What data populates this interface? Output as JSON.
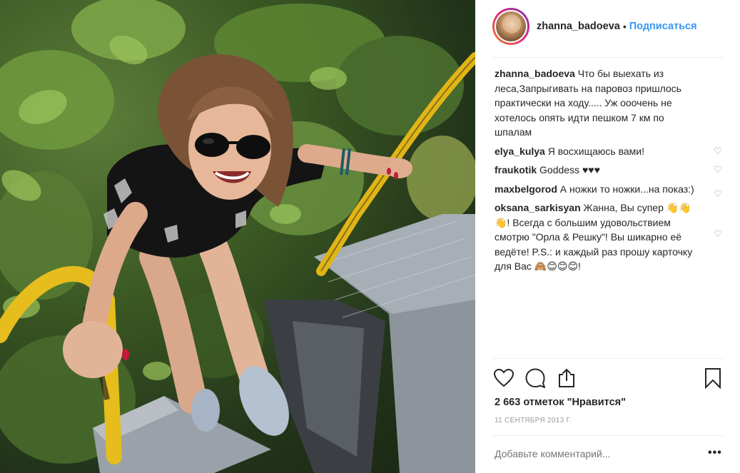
{
  "post": {
    "image_alt": "Woman in sunglasses climbing a locomotive ladder with yellow handrails in a forest"
  },
  "header": {
    "username": "zhanna_badoeva",
    "separator": "•",
    "follow_label": "Подписаться"
  },
  "caption": {
    "author": "zhanna_badoeva",
    "text": "Что бы выехать из леса,Запрыгивать на паровоз пришлось практически на ходу..... Уж ооочень не хотелось опять идти пешком 7 км по шпалам"
  },
  "comments": [
    {
      "author": "elya_kulya",
      "text": "Я восхищаюсь вами!"
    },
    {
      "author": "fraukotik",
      "text": "Goddess ♥♥♥"
    },
    {
      "author": "maxbelgorod",
      "text": "А ножки то ножки...на показ:)"
    },
    {
      "author": "oksana_sarkisyan",
      "text": "Жанна, Вы супер 👋👋👋! Всегда с большим удовольствием смотрю \"Орла & Решку\"! Вы шикарно её ведёте! P.S.: и каждый раз прошу карточку для Вас 🙈😊😊😊!"
    }
  ],
  "icons": {
    "comment_like": "heart-outline-icon",
    "like": "heart-icon",
    "comment": "speech-bubble-icon",
    "share": "share-icon",
    "save": "bookmark-icon",
    "more": "ellipsis-icon"
  },
  "likes_text": "2 663 отметок \"Нравится\"",
  "date_text": "11 сентября 2013 г.",
  "add_comment_placeholder": "Добавьте комментарий...",
  "more_label": "•••",
  "colors": {
    "accent": "#3897f0",
    "text": "#262626",
    "muted": "#999999",
    "divider": "#efefef"
  }
}
